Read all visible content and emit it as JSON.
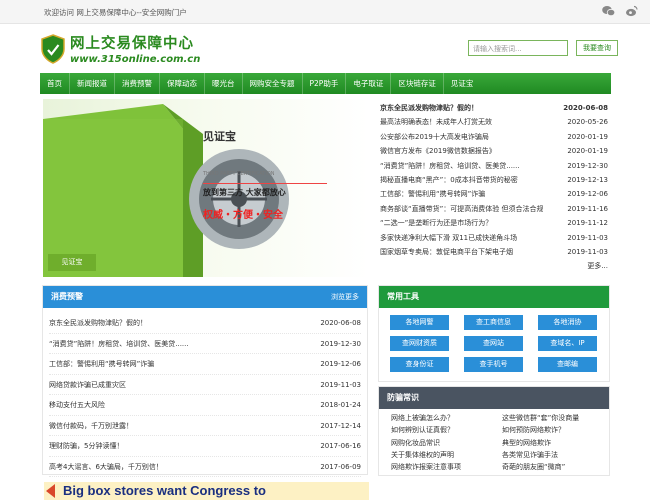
{
  "topbar": {
    "welcome": "欢迎访问 网上交易保障中心--安全网购门户"
  },
  "logo": {
    "title": "网上交易保障中心",
    "url": "www.315online.com.cn"
  },
  "search": {
    "placeholder": "请输入搜索词...",
    "button": "我要查询"
  },
  "nav": [
    "首页",
    "新闻报道",
    "消费预警",
    "保障动态",
    "曝光台",
    "网购安全专题",
    "P2P助手",
    "电子取证",
    "区块链存证",
    "见证宝"
  ],
  "banner": {
    "title": "见证宝",
    "sub": "THIRD PARTY CERTIFICATION",
    "slogan": "放到第三方  大家都放心",
    "tags": "权威・方便・安全",
    "corner_label": "见证宝"
  },
  "news": {
    "items": [
      {
        "title": "京东全民派发购物津贴？假的！",
        "date": "2020-06-08"
      },
      {
        "title": "最高法明确表态！未成年人打赏无效",
        "date": "2020-05-26"
      },
      {
        "title": "公安部公布2019十大高发电诈骗局",
        "date": "2020-01-19"
      },
      {
        "title": "微信官方发布《2019微信数据报告》",
        "date": "2020-01-19"
      },
      {
        "title": "“消费贷”陷阱！房租贷、培训贷、医美贷......",
        "date": "2019-12-30"
      },
      {
        "title": "揭秘直播电商“黑产”：0成本抖音带货的秘密",
        "date": "2019-12-13"
      },
      {
        "title": "工信部：警惕利用“携号转网”诈骗",
        "date": "2019-12-06"
      },
      {
        "title": "商务部谈“直播带货”：可提高消费体验 但须合法合规",
        "date": "2019-11-16"
      },
      {
        "title": "“二选一”是垄断行为还是市场行为？",
        "date": "2019-11-12"
      },
      {
        "title": "多家快递净利大幅下滑 双11已成快递角斗场",
        "date": "2019-11-03"
      },
      {
        "title": "国家烟草专卖局：敦促电商平台下架电子烟",
        "date": "2019-11-03"
      }
    ],
    "more": "更多..."
  },
  "warning": {
    "title": "消费预警",
    "more": "浏览更多",
    "items": [
      {
        "title": "京东全民派发购物津贴？假的！",
        "date": "2020-06-08"
      },
      {
        "title": "“消费贷”陷阱！房租贷、培训贷、医美贷......",
        "date": "2019-12-30"
      },
      {
        "title": "工信部：警惕利用“携号转网”诈骗",
        "date": "2019-12-06"
      },
      {
        "title": "网络贷款诈骗已成重灾区",
        "date": "2019-11-03"
      },
      {
        "title": "移动支付五大风险",
        "date": "2018-01-24"
      },
      {
        "title": "微信付款码，千万别泄露！",
        "date": "2017-12-14"
      },
      {
        "title": "理财防骗，5分钟读懂！",
        "date": "2017-06-16"
      },
      {
        "title": "高考4大谣言、6大骗局，千万别信！",
        "date": "2017-06-09"
      }
    ]
  },
  "tools": {
    "title": "常用工具",
    "items": [
      "各地网警",
      "查工商信息",
      "各地消协",
      "查网财资质",
      "查网站",
      "查域名、IP",
      "查身份证",
      "查手机号",
      "查邮编"
    ]
  },
  "fraud": {
    "title": "防骗常识",
    "items": [
      "网络上被骗怎么办？",
      "这些微信群“套”你没商量",
      "如何辨别认证真假？",
      "如何预防网络欺诈？",
      "网购化妆品常识",
      "典型的网络欺诈",
      "关于集体维权的声明",
      "各类常见诈骗手法",
      "网络欺诈报案注意事项",
      "奇葩的朋友圈“微商”"
    ]
  },
  "ad": {
    "text": "Big box stores want Congress to"
  },
  "colors": {
    "green": "#2a8a1f",
    "blue": "#2a8fd8",
    "tool_head": "#1f9a3c",
    "fraud_head": "#4a5461"
  }
}
